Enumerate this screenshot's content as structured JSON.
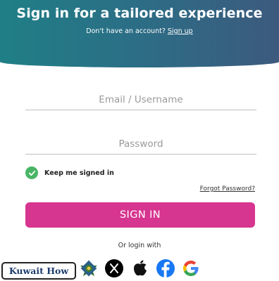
{
  "header": {
    "title": "Sign in for a tailored experience",
    "no_account_text": "Don't have an account?",
    "signup_link": "Sign up"
  },
  "form": {
    "email_placeholder": "Email / Username",
    "password_placeholder": "Password",
    "remember_label": "Keep me signed in",
    "remember_checked": true,
    "forgot_link": "Forgot Password?",
    "signin_button": "SIGN IN",
    "or_login_with": "Or login with"
  },
  "social": {
    "providers": [
      "emblem",
      "x",
      "apple",
      "facebook",
      "google"
    ]
  },
  "watermark": "Kuwait How",
  "colors": {
    "header_gradient_start": "#1f7f86",
    "header_gradient_end": "#3c5a7e",
    "signin_button": "#d63590",
    "check": "#48b565",
    "facebook": "#1877f2"
  }
}
